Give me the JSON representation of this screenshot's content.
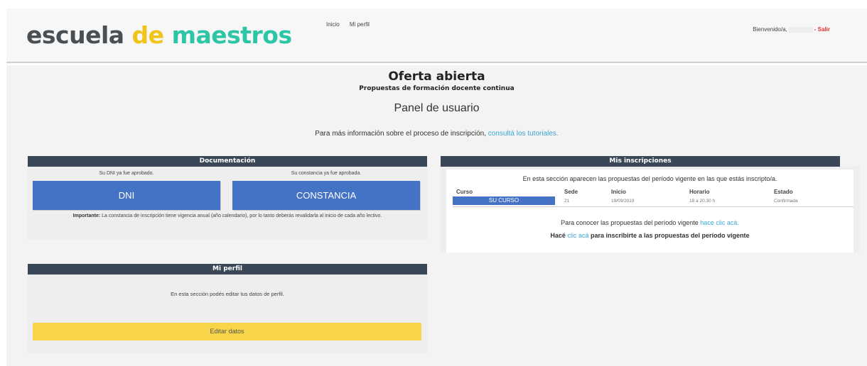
{
  "header": {
    "logo": {
      "word1": "escuela",
      "word2": "de",
      "word3": "maestros"
    },
    "nav": [
      "Inicio",
      "Mi perfil"
    ],
    "welcome": "Bienvenido/a,",
    "logout": "- Salir",
    "colors": {
      "logo_gray": "#4a4f54",
      "logo_yellow": "#f0c419",
      "logo_teal": "#2cc5a5",
      "logout": "#e0302e"
    }
  },
  "main": {
    "title": "Oferta abierta",
    "subtitle": "Propuestas de formación docente continua",
    "panel_title": "Panel de usuario",
    "info_text": "Para más información sobre el proceso de inscripción,",
    "info_link": "consultá los tutoriales."
  },
  "documentacion": {
    "title": "Documentación",
    "dni_status": "Su DNI ya fue aprobado.",
    "constancia_status": "Su constancia ya fue aprobada.",
    "dni_button": "DNI",
    "constancia_button": "CONSTANCIA",
    "note_bold": "Importante:",
    "note_text": "La constancia de inscripción tiene vigencia anual (año calendario), por lo tanto deberás revalidarla al inicio de cada año lectivo."
  },
  "inscripciones": {
    "title": "Mis inscripciones",
    "intro": "En esta sección aparecen las propuestas del período vigente en las que estás inscripto/a.",
    "columns": [
      "Curso",
      "Sede",
      "Inicio",
      "Horario",
      "Estado"
    ],
    "rows": [
      {
        "curso": "SU CURSO",
        "sede": "21",
        "inicio": "19/09/2019",
        "horario": "18 a 20.30 h",
        "estado": "Confirmada"
      }
    ],
    "conocer_text": "Para conocer las propuestas del período vigente",
    "conocer_link": "hace clic acá.",
    "inscribirse_pre": "Hacé",
    "inscribirse_link": "clic acá",
    "inscribirse_post": "para inscribirte a las propuestas del período vigente"
  },
  "perfil": {
    "title": "Mi perfil",
    "text": "En esta sección podés editar tus datos de perfil.",
    "button": "Editar datos"
  },
  "colors": {
    "panel_header": "#3a4756",
    "blue_button": "#4472c4",
    "yellow_button": "#f8d548",
    "link": "#3aa6d6"
  }
}
